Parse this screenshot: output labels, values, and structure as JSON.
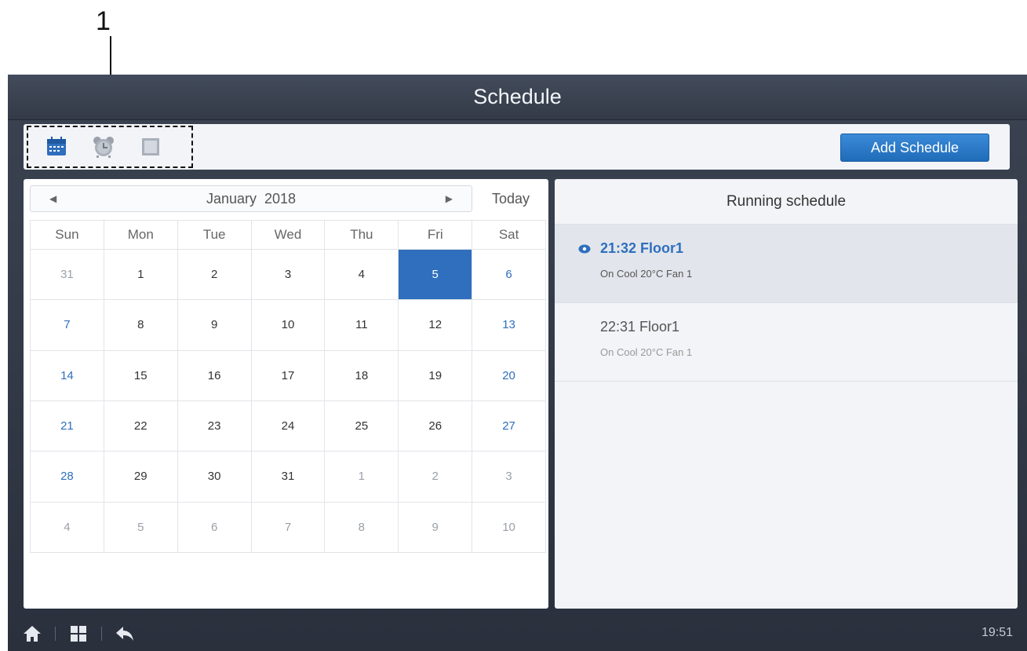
{
  "annotation": {
    "number": "1"
  },
  "window": {
    "title": "Schedule"
  },
  "toolbar": {
    "add_schedule_label": "Add Schedule"
  },
  "view_switcher": [
    "calendar-icon",
    "alarm-clock-icon",
    "list-icon"
  ],
  "calendar": {
    "month_label": "January",
    "year_label": "2018",
    "today_label": "Today",
    "weekdays": [
      "Sun",
      "Mon",
      "Tue",
      "Wed",
      "Thu",
      "Fri",
      "Sat"
    ],
    "weeks": [
      [
        "31",
        "1",
        "2",
        "3",
        "4",
        "5",
        "6"
      ],
      [
        "7",
        "8",
        "9",
        "10",
        "11",
        "12",
        "13"
      ],
      [
        "14",
        "15",
        "16",
        "17",
        "18",
        "19",
        "20"
      ],
      [
        "21",
        "22",
        "23",
        "24",
        "25",
        "26",
        "27"
      ],
      [
        "28",
        "29",
        "30",
        "31",
        "1",
        "2",
        "3"
      ],
      [
        "4",
        "5",
        "6",
        "7",
        "8",
        "9",
        "10"
      ]
    ],
    "selected_day": "5"
  },
  "running": {
    "title": "Running schedule",
    "items": [
      {
        "time_label": "21:32 Floor1",
        "detail": "On Cool 20°C Fan 1",
        "active": true
      },
      {
        "time_label": "22:31 Floor1",
        "detail": "On Cool 20°C Fan 1",
        "active": false
      }
    ]
  },
  "bottom_bar": {
    "icons": [
      "home-icon",
      "apps-grid-icon",
      "back-icon"
    ],
    "clock": "19:51"
  },
  "colors": {
    "accent": "#2f6fbd",
    "title_bar": "#3b4352",
    "panel": "#f2f4f7"
  }
}
